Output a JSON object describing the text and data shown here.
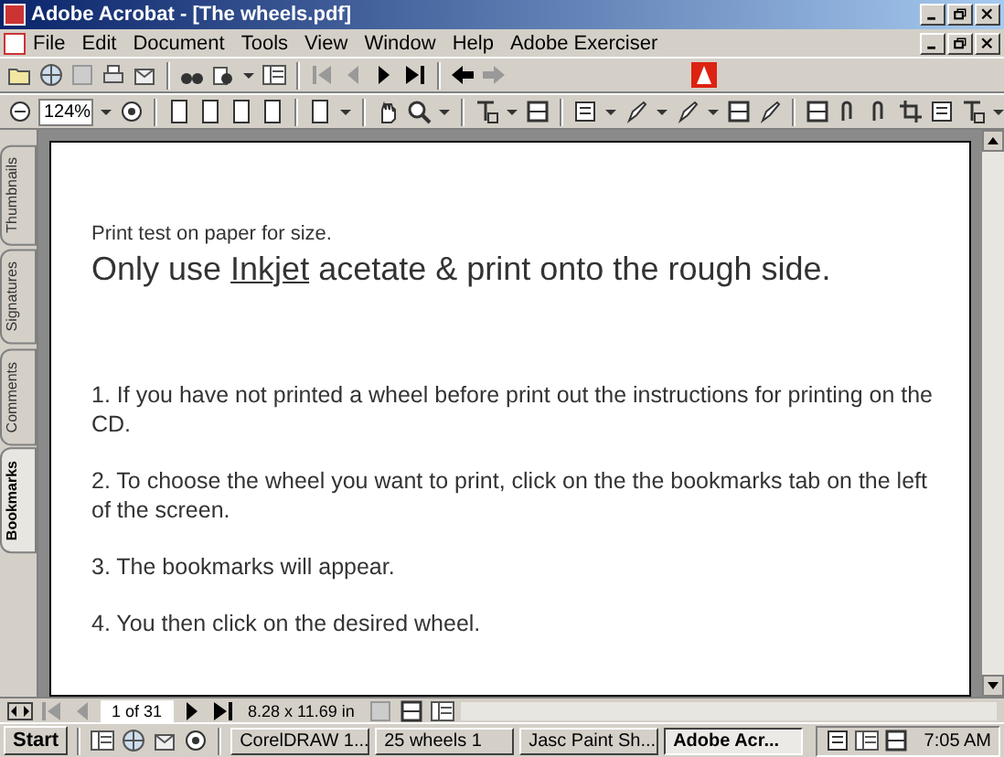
{
  "window": {
    "title": "Adobe Acrobat - [The wheels.pdf]"
  },
  "menu": [
    "File",
    "Edit",
    "Document",
    "Tools",
    "View",
    "Window",
    "Help",
    "Adobe Exerciser"
  ],
  "zoom": {
    "value": "124%"
  },
  "side_tabs": [
    {
      "label": "Thumbnails",
      "selected": false
    },
    {
      "label": "Signatures",
      "selected": false
    },
    {
      "label": "Comments",
      "selected": false
    },
    {
      "label": "Bookmarks",
      "selected": true
    }
  ],
  "document": {
    "note": "Print test on paper for size.",
    "heading": {
      "before": "Only use",
      "underlined": "Inkjet",
      "after": "acetate & print onto the rough side."
    },
    "paragraphs": [
      "1. If you have not printed a wheel before print out the instructions for printing on the CD.",
      "2. To choose the wheel you want to print, click on the  the bookmarks tab on the left of the screen.",
      "3. The bookmarks will appear.",
      "4. You then click on the desired wheel."
    ]
  },
  "status_bar": {
    "page": "1 of 31",
    "size": "8.28 x 11.69 in"
  },
  "taskbar": {
    "start": "Start",
    "tasks": [
      {
        "label": "CorelDRAW 1...",
        "selected": false
      },
      {
        "label": "25 wheels 1",
        "selected": false
      },
      {
        "label": "Jasc Paint Sh...",
        "selected": false
      },
      {
        "label": "Adobe Acr...",
        "selected": true
      }
    ],
    "clock": "7:05 AM"
  }
}
